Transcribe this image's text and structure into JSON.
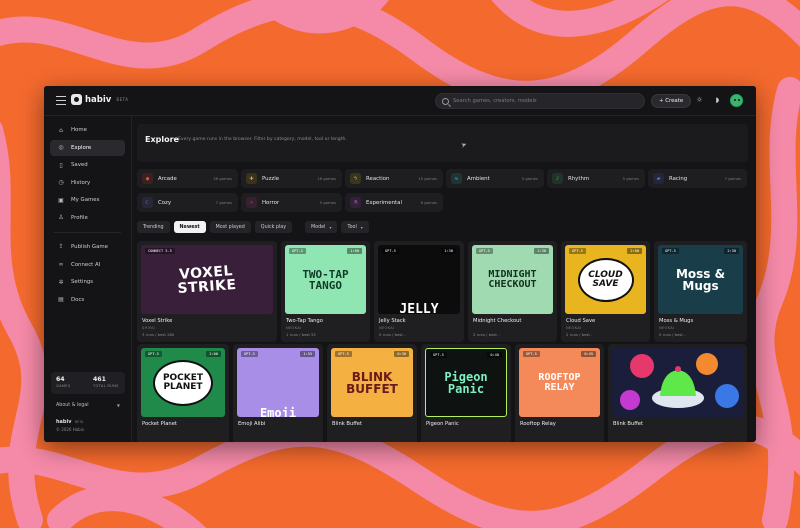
{
  "app": {
    "logo": "habiv",
    "beta": "BETA",
    "search_placeholder": "Search games, creators, models",
    "create_label": "+ Create"
  },
  "sidebar": {
    "items": [
      {
        "label": "Home",
        "icon": "home-icon",
        "active": false
      },
      {
        "label": "Explore",
        "icon": "compass-icon",
        "active": true
      },
      {
        "label": "Saved",
        "icon": "bookmark-icon",
        "active": false
      },
      {
        "label": "History",
        "icon": "clock-icon",
        "active": false
      },
      {
        "label": "My Games",
        "icon": "gamepad-icon",
        "active": false
      },
      {
        "label": "Profile",
        "icon": "user-icon",
        "active": false
      }
    ],
    "items2": [
      {
        "label": "Publish Game",
        "icon": "upload-icon"
      },
      {
        "label": "Connect AI",
        "icon": "link-icon"
      },
      {
        "label": "Settings",
        "icon": "gear-icon"
      },
      {
        "label": "Docs",
        "icon": "doc-icon"
      }
    ],
    "stats": [
      {
        "num": "64",
        "label": "GAMES"
      },
      {
        "num": "461",
        "label": "TOTAL RUNS"
      }
    ],
    "about": "About & legal",
    "footer_logo": "habiv",
    "footer_beta": "BETA",
    "footer_copy": "© 2026 Habiv"
  },
  "explore": {
    "title": "Explore",
    "subtitle": "Every game runs in the browser. Filter by category, model, tool or length."
  },
  "categories": [
    {
      "label": "Arcade",
      "count": "38 games",
      "color": "#e2574c"
    },
    {
      "label": "Puzzle",
      "count": "18 games",
      "color": "#d9a441"
    },
    {
      "label": "Reaction",
      "count": "15 games",
      "color": "#e8c840"
    },
    {
      "label": "Ambient",
      "count": "5 games",
      "color": "#4cc9d6"
    },
    {
      "label": "Rhythm",
      "count": "5 games",
      "color": "#3fb37a"
    },
    {
      "label": "Racing",
      "count": "7 games",
      "color": "#5a7ae0"
    },
    {
      "label": "Cozy",
      "count": "7 games",
      "color": "#8a8ad0"
    },
    {
      "label": "Horror",
      "count": "5 games",
      "color": "#b04a8a"
    },
    {
      "label": "Experimental",
      "count": "6 games",
      "color": "#c44ad0"
    }
  ],
  "chips": [
    "Trending",
    "Newest",
    "Most played",
    "Quick play"
  ],
  "active_chip": "Newest",
  "selects": [
    "Model",
    "Tool"
  ],
  "games": [
    {
      "title": "Voxel Strike",
      "meta1": "SHIFAI",
      "meta2": "3 runs / best 280",
      "tag": "CONNECT 3.5",
      "time": "",
      "art": "VOXEL\nSTRIKE"
    },
    {
      "title": "Two-Tap Tango",
      "meta1": "NEOKAI",
      "meta2": "1 runs / best 52",
      "tag": "GPT-5",
      "time": "1:00",
      "art": "TWO-TAP\nTANGO"
    },
    {
      "title": "Jelly Stack",
      "meta1": "NEOKAI",
      "meta2": "0 runs / best -",
      "tag": "GPT-5",
      "time": "1:30",
      "art": "JELLY"
    },
    {
      "title": "Midnight Checkout",
      "meta1": "",
      "meta2": "2 runs / best -",
      "tag": "GPT-5",
      "time": "1:30",
      "art": "MIDNIGHT\nCHECKOUT"
    },
    {
      "title": "Cloud Save",
      "meta1": "NEOKAI",
      "meta2": "2 runs / best -",
      "tag": "GPT-5",
      "time": "2:00",
      "art": "CLOUD\nSAVE"
    },
    {
      "title": "Moss & Mugs",
      "meta1": "NEOKAI",
      "meta2": "0 runs / best -",
      "tag": "GPT-5",
      "time": "2:30",
      "art": "Moss &\nMugs"
    },
    {
      "title": "Pocket Planet",
      "meta1": "",
      "meta2": "",
      "tag": "GPT-5",
      "time": "2:00",
      "art": "POCKET\nPLANET"
    },
    {
      "title": "Emoji Alibi",
      "meta1": "",
      "meta2": "",
      "tag": "GPT-5",
      "time": "1:55",
      "art": "Emoji"
    },
    {
      "title": "Blink Buffet",
      "meta1": "",
      "meta2": "",
      "tag": "GPT-5",
      "time": "0:30",
      "art": "BLINK\nBUFFET"
    },
    {
      "title": "Pigeon Panic",
      "meta1": "",
      "meta2": "",
      "tag": "GPT-5",
      "time": "0:40",
      "art": "Pigeon\nPanic"
    },
    {
      "title": "Rooftop Relay",
      "meta1": "",
      "meta2": "",
      "tag": "GPT-5",
      "time": "0:45",
      "art": "ROOFTOP\nRELAY"
    },
    {
      "title": "Blink Buffet",
      "meta1": "",
      "meta2": "",
      "tag": "",
      "time": "",
      "art": ""
    }
  ],
  "colors": {
    "background_orange": "#f46a2e",
    "background_pink": "#f58aa8",
    "app_bg": "#141416",
    "accent_green": "#3cb371"
  }
}
